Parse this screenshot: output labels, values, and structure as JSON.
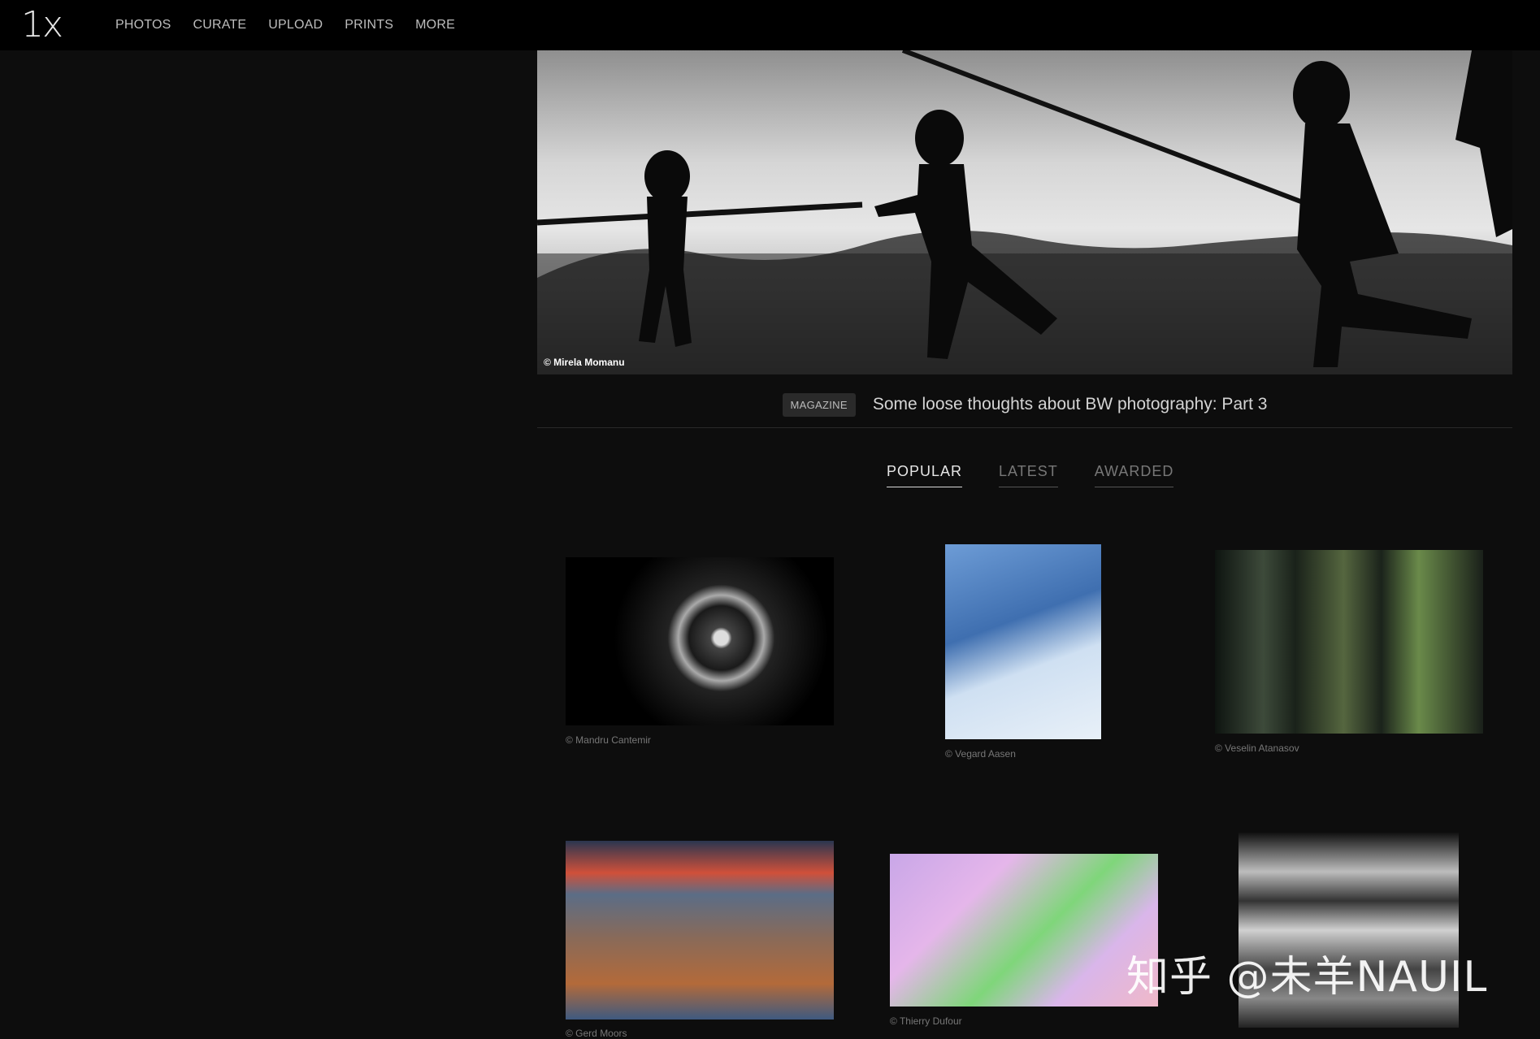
{
  "logo": "1x",
  "nav": [
    "PHOTOS",
    "CURATE",
    "UPLOAD",
    "PRINTS",
    "MORE"
  ],
  "hero": {
    "credit": "© Mirela Momanu",
    "badge": "MAGAZINE",
    "title": "Some loose thoughts about BW photography: Part 3"
  },
  "tabs": [
    {
      "label": "POPULAR",
      "active": true
    },
    {
      "label": "LATEST",
      "active": false
    },
    {
      "label": "AWARDED",
      "active": false
    }
  ],
  "photos": [
    {
      "credit": "© Mandru Cantemir"
    },
    {
      "credit": "© Vegard Aasen"
    },
    {
      "credit": "© Veselin Atanasov"
    },
    {
      "credit": "© Gerd Moors"
    },
    {
      "credit": "© Thierry Dufour"
    },
    {
      "credit": ""
    }
  ],
  "watermark": "知乎 @未羊NAUIL"
}
